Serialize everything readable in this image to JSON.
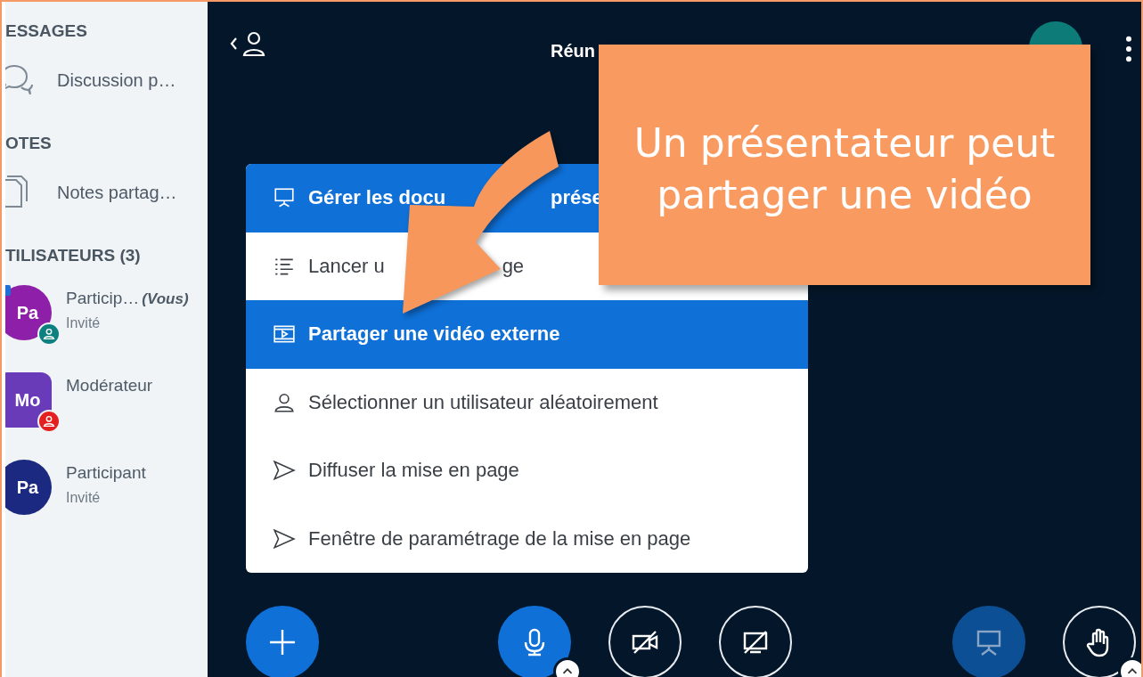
{
  "sidebar": {
    "sections": [
      {
        "heading": "ESSAGES",
        "items": [
          {
            "kind": "chat",
            "label": "Discussion p…"
          }
        ]
      },
      {
        "heading": "OTES",
        "items": [
          {
            "kind": "notes",
            "label": "Notes partag…"
          }
        ]
      }
    ],
    "users_heading": "TILISATEURS (3)",
    "users": [
      {
        "initials": "Pa",
        "name": "Particip…",
        "you": "(Vous)",
        "role": "Invité",
        "kind": "presenter",
        "color": "#8e1fa8",
        "presenter": true
      },
      {
        "initials": "Mo",
        "name": "Modérateur",
        "kind": "moderator",
        "color": "#6a3bb8",
        "presenter": false
      },
      {
        "initials": "Pa",
        "name": "Participant",
        "role": "Invité",
        "kind": "viewer",
        "color": "#1b2a80",
        "presenter": false
      }
    ]
  },
  "top_bar": {
    "title": "Réun"
  },
  "menu": {
    "items": [
      {
        "kind": "presentation",
        "parts": [
          "Gérer les docu",
          "prése"
        ],
        "highlighted": true
      },
      {
        "kind": "list",
        "parts": [
          "Lancer u",
          "ge"
        ],
        "highlighted": false
      },
      {
        "kind": "video",
        "parts": [
          "Partager une vidéo externe"
        ],
        "highlighted": true
      },
      {
        "kind": "user",
        "parts": [
          "Sélectionner un utilisateur aléatoirement"
        ],
        "highlighted": false
      },
      {
        "kind": "send",
        "parts": [
          "Diffuser la mise en page"
        ],
        "highlighted": false
      },
      {
        "kind": "send",
        "parts": [
          "Fenêtre de paramétrage de la mise en page"
        ],
        "highlighted": false
      }
    ]
  },
  "controls": [
    {
      "kind": "plus",
      "on": true,
      "chevron": false
    },
    {
      "kind": "mic",
      "on": true,
      "chevron": true
    },
    {
      "kind": "camera",
      "on": false,
      "chevron": false
    },
    {
      "kind": "screen",
      "on": false,
      "chevron": false
    },
    {
      "kind": "presentation",
      "on": true,
      "chevron": false
    },
    {
      "kind": "hand",
      "on": false,
      "chevron": true
    }
  ],
  "callout": {
    "lines": [
      "Un présentateur peut",
      "partager une vidéo"
    ]
  }
}
